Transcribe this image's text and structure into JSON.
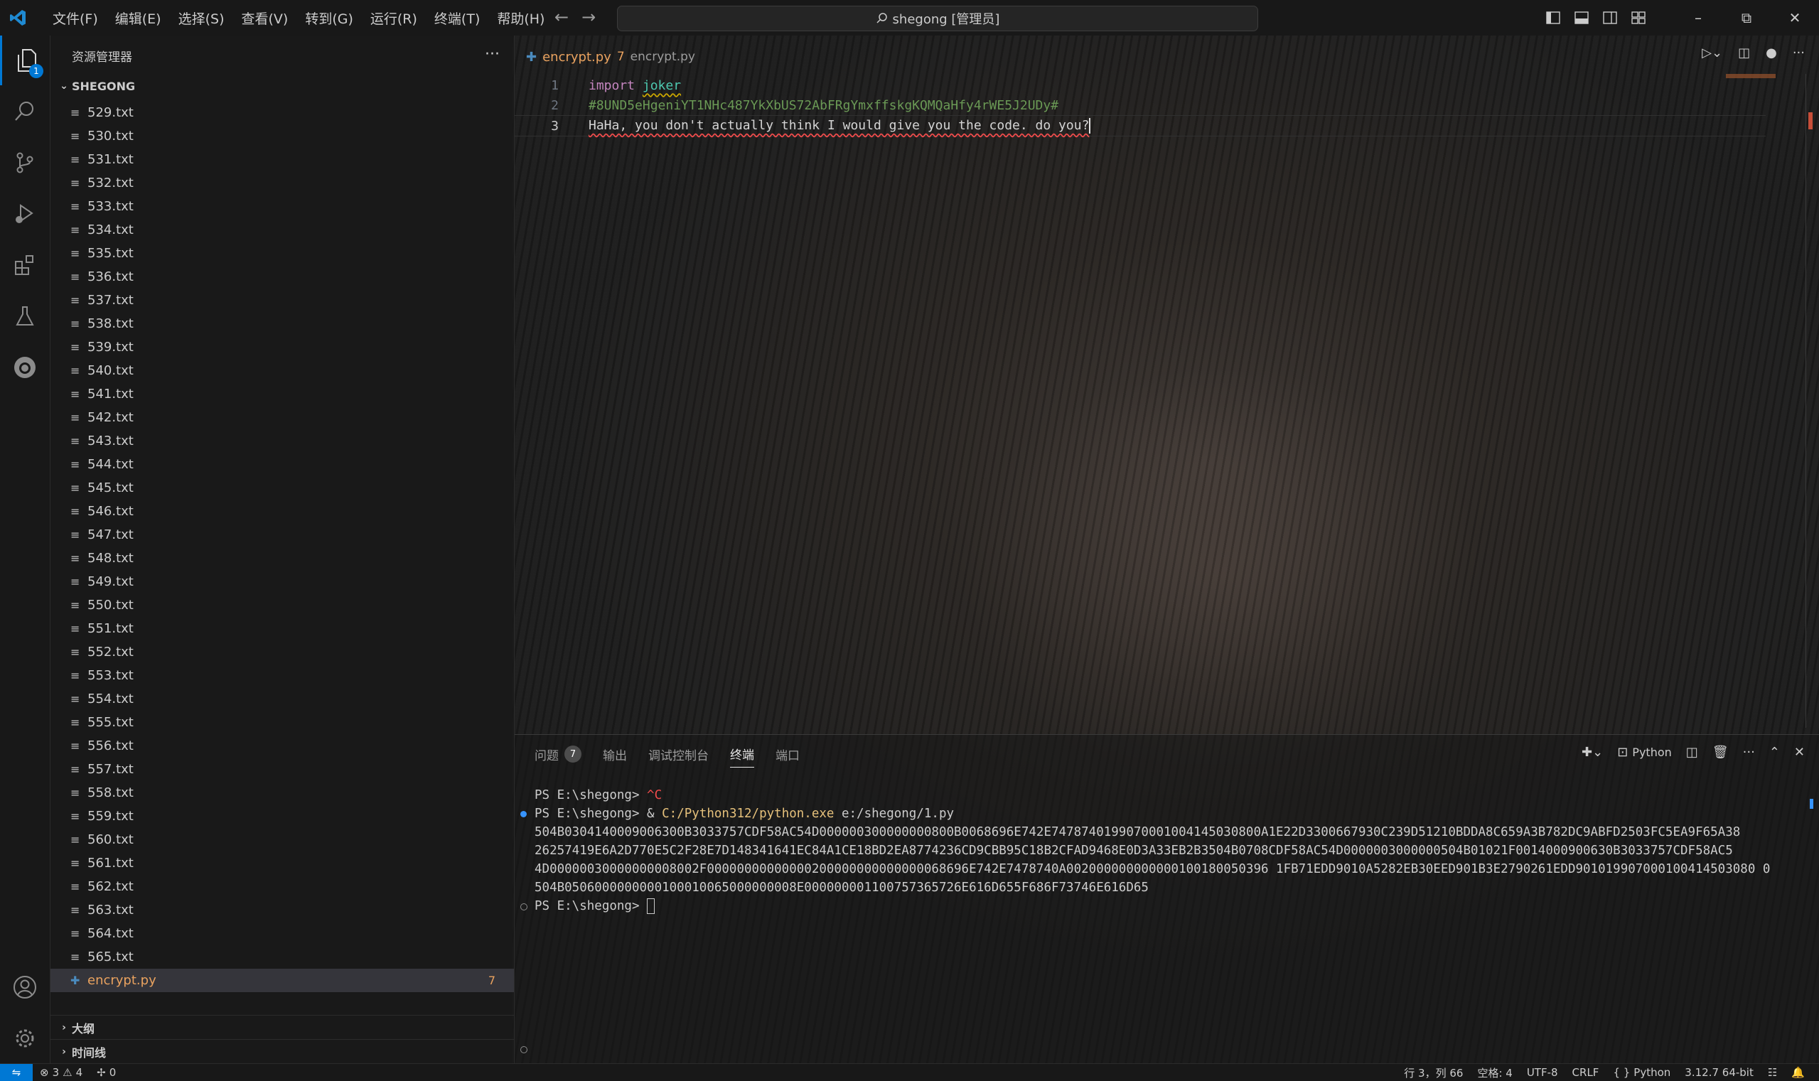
{
  "titlebar": {
    "menu": [
      "文件(F)",
      "编辑(E)",
      "选择(S)",
      "查看(V)",
      "转到(G)",
      "运行(R)",
      "终端(T)",
      "帮助(H)"
    ],
    "search_text": "shegong [管理员]"
  },
  "activity": {
    "explorer_badge": "1"
  },
  "sidebar": {
    "title": "资源管理器",
    "folder": "SHEGONG",
    "files": [
      "529.txt",
      "530.txt",
      "531.txt",
      "532.txt",
      "533.txt",
      "534.txt",
      "535.txt",
      "536.txt",
      "537.txt",
      "538.txt",
      "539.txt",
      "540.txt",
      "541.txt",
      "542.txt",
      "543.txt",
      "544.txt",
      "545.txt",
      "546.txt",
      "547.txt",
      "548.txt",
      "549.txt",
      "550.txt",
      "551.txt",
      "552.txt",
      "553.txt",
      "554.txt",
      "555.txt",
      "556.txt",
      "557.txt",
      "558.txt",
      "559.txt",
      "560.txt",
      "561.txt",
      "562.txt",
      "563.txt",
      "564.txt",
      "565.txt"
    ],
    "selected_file": {
      "name": "encrypt.py",
      "problems": "7"
    },
    "sections": [
      "大纲",
      "时间线"
    ]
  },
  "editor": {
    "tab": {
      "name": "encrypt.py",
      "problems": "7",
      "description": "encrypt.py"
    },
    "lines": [
      {
        "number": "1",
        "keyword": "import",
        "module": "joker"
      },
      {
        "number": "2",
        "comment": "#8UND5eHgeniYT1NHc487YkXbUS72AbFRgYmxffskgKQMQaHfy4rWE5J2UDy#"
      },
      {
        "number": "3",
        "text": "HaHa, you don't actually think I would give you the code. do you?"
      }
    ]
  },
  "panel": {
    "tabs": [
      {
        "label": "问题",
        "badge": "7"
      },
      {
        "label": "输出"
      },
      {
        "label": "调试控制台"
      },
      {
        "label": "终端",
        "active": true
      },
      {
        "label": "端口"
      }
    ],
    "shell_label": "Python",
    "terminal": {
      "line1_prompt": "PS E:\\shegong> ",
      "line1_ctrlc": "^C",
      "line2_prompt": "PS E:\\shegong> & ",
      "line2_exe": "C:/Python312/python.exe",
      "line2_arg": " e:/shegong/1.py",
      "output": [
        "504B0304140009006300B3033757CDF58AC54D000000300000000800B0068696E742E7478740199070001004145030800A1E22D3300667930C239D51210BDDA8C659A3B782DC9ABFD2503FC5EA9F65A38",
        "26257419E6A2D770E5C2F28E7D148341641EC84A1CE18BD2EA8774236CD9CBB95C18B2CFAD9468E0D3A33EB2B3504B0708CDF58AC54D0000003000000504B01021F0014000900630B3033757CDF58AC5",
        "4D00000030000000008002F00000000000000200000000000000068696E742E7478740A002000000000000100180050396 1FB71EDD9010A5282EB30EED901B3E2790261EDD901019907000100414503080 0",
        "504B0506000000000100010065000000008E000000001100757365726E616D655F686F73746E616D65"
      ],
      "last_prompt": "PS E:\\shegong> "
    }
  },
  "statusbar": {
    "errors": "3",
    "warnings": "4",
    "ports": "0",
    "position": "行 3，列 66",
    "spaces": "空格: 4",
    "encoding": "UTF-8",
    "eol": "CRLF",
    "language": "Python",
    "interpreter": "3.12.7 64-bit"
  }
}
